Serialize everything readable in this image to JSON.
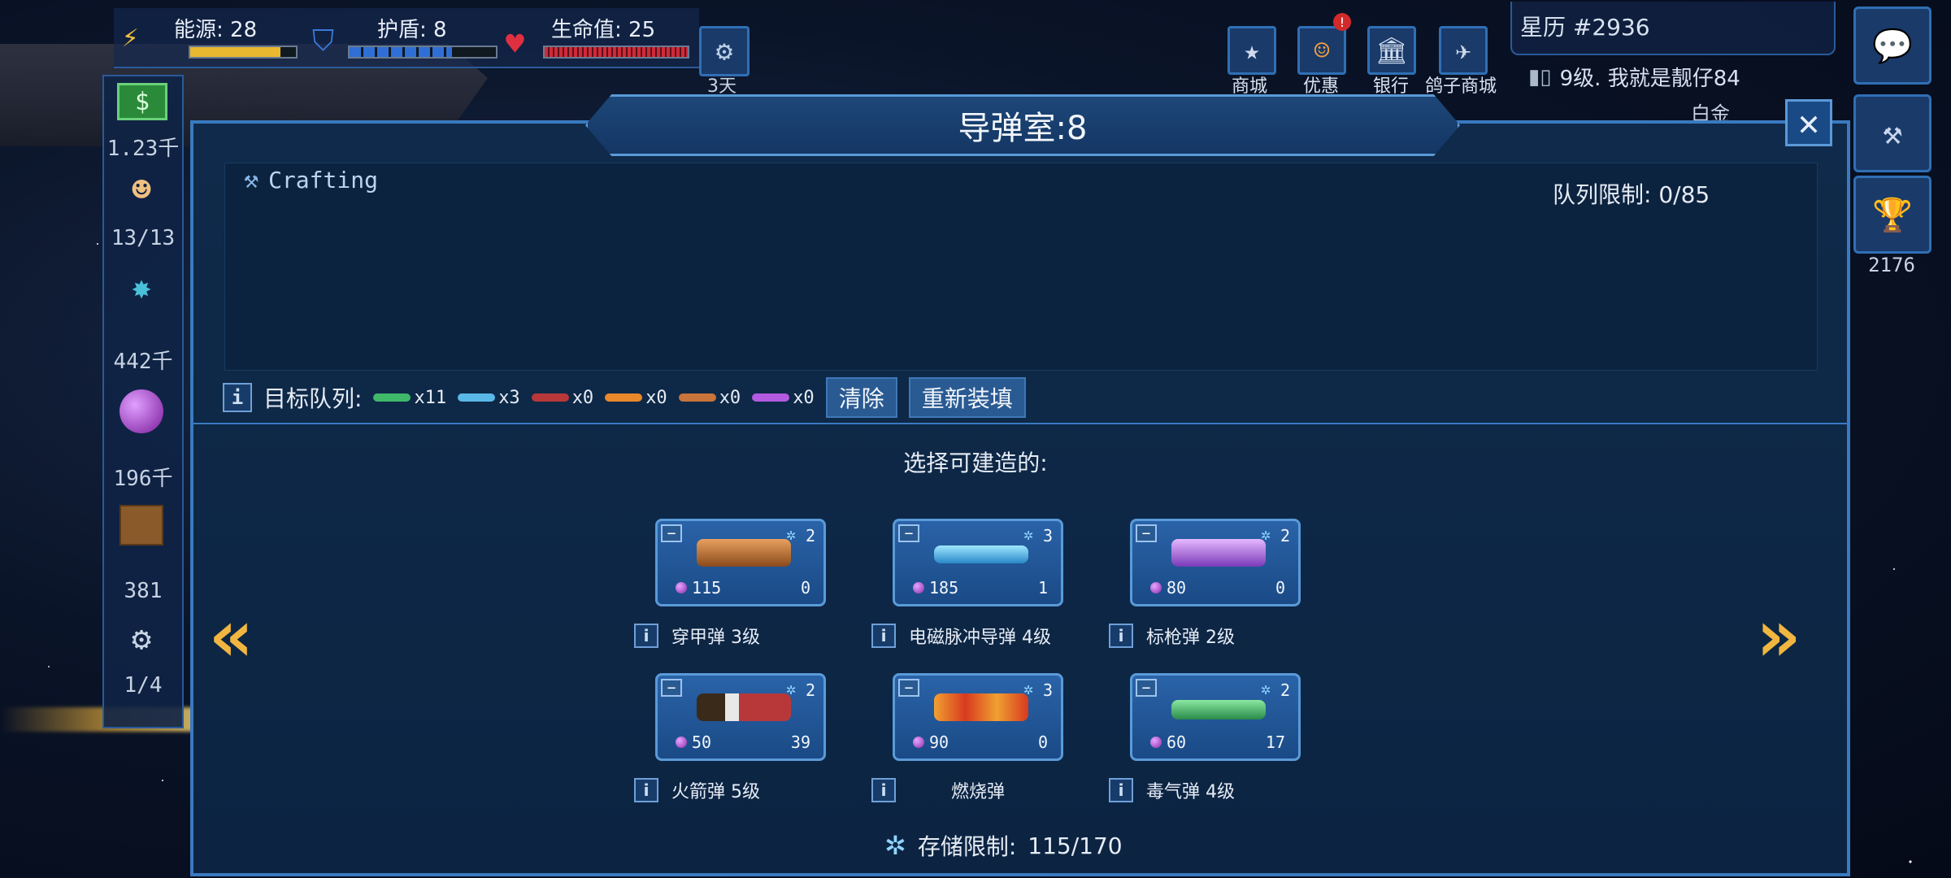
{
  "top": {
    "energy_label": "能源: 28",
    "shield_label": "护盾: 8",
    "health_label": "生命值: 25",
    "energy_fraction": 0.85,
    "shield_fraction": 0.7,
    "health_fraction": 1.0,
    "days_label": "3天",
    "buttons": [
      {
        "label": "商城",
        "icon": "star-icon"
      },
      {
        "label": "优惠",
        "icon": "smiley-icon"
      },
      {
        "label": "银行",
        "icon": "bank-icon"
      },
      {
        "label": "鸽子商城",
        "icon": "bird-icon"
      }
    ],
    "calendar": "星历 #2936",
    "rank": "9级. 我就是靓仔84",
    "platinum": "白金",
    "trophy_count": "2176"
  },
  "left": {
    "values": [
      "1.23千",
      "13/13",
      "442千",
      "196千",
      "381",
      "1/4"
    ]
  },
  "panel": {
    "title": "导弹室:8",
    "crafting_label": "Crafting",
    "queue_limit": "队列限制:  0/85",
    "target_label": "目标队列:",
    "queue": [
      {
        "count": "x11",
        "color": "#3fb86a"
      },
      {
        "count": "x3",
        "color": "#5ab8e8"
      },
      {
        "count": "x0",
        "color": "#b8383a"
      },
      {
        "count": "x0",
        "color": "#e8882a"
      },
      {
        "count": "x0",
        "color": "#c8743a"
      },
      {
        "count": "x0",
        "color": "#b45ae0"
      }
    ],
    "clear_label": "清除",
    "reload_label": "重新装填",
    "select_title": "选择可建造的:",
    "storage_label": "存储限制:",
    "storage_value": "115/170",
    "items": [
      {
        "name": "穿甲弹 3级",
        "level": "2",
        "cost": "115",
        "count": "0",
        "color": "#c8783a"
      },
      {
        "name": "电磁脉冲导弹 4级",
        "level": "3",
        "cost": "185",
        "count": "1",
        "color": "#6ec8f0"
      },
      {
        "name": "标枪弹 2级",
        "level": "2",
        "cost": "80",
        "count": "0",
        "color": "#b86ae8"
      },
      {
        "name": "火箭弹 5级",
        "level": "2",
        "cost": "50",
        "count": "39",
        "color": "#b8383a"
      },
      {
        "name": "燃烧弹",
        "level": "3",
        "cost": "90",
        "count": "0",
        "color": "#e87a2a"
      },
      {
        "name": "毒气弹 4级",
        "level": "2",
        "cost": "60",
        "count": "17",
        "color": "#3fb86a"
      }
    ]
  }
}
